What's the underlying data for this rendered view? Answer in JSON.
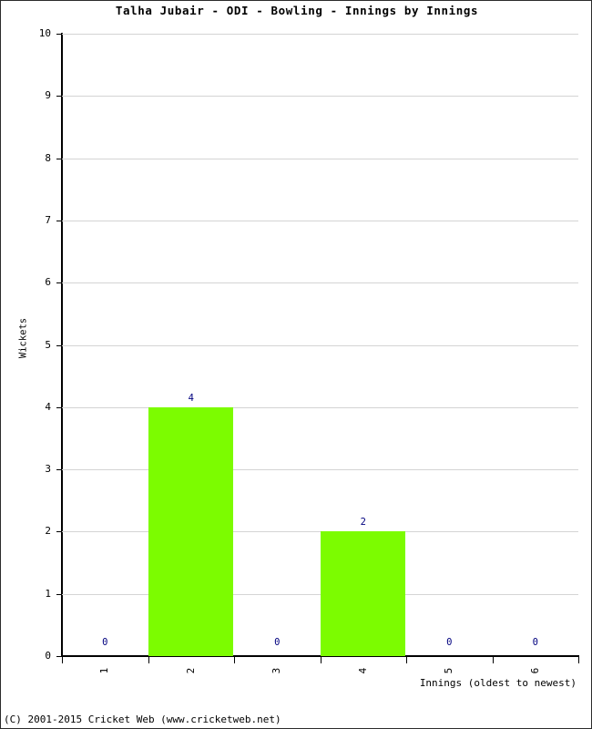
{
  "chart_data": {
    "type": "bar",
    "title": "Talha Jubair - ODI - Bowling - Innings by Innings",
    "xlabel": "Innings (oldest to newest)",
    "ylabel": "Wickets",
    "categories": [
      "1",
      "2",
      "3",
      "4",
      "5",
      "6"
    ],
    "values": [
      0,
      4,
      0,
      2,
      0,
      0
    ],
    "point_labels": [
      "0",
      "4",
      "0",
      "2",
      "0",
      "0"
    ],
    "ylim": [
      0,
      10
    ],
    "yticks": [
      0,
      1,
      2,
      3,
      4,
      5,
      6,
      7,
      8,
      9,
      10
    ],
    "ytick_labels": [
      "0",
      "1",
      "2",
      "3",
      "4",
      "5",
      "6",
      "7",
      "8",
      "9",
      "10"
    ],
    "grid": true,
    "legend": false,
    "bar_color": "#7cfc00",
    "label_color": "#00007f",
    "grid_color": "#d4d4d4",
    "axis_color": "#000000",
    "background": "#ffffff"
  },
  "footer": {
    "copyright": "(C) 2001-2015 Cricket Web (www.cricketweb.net)"
  }
}
